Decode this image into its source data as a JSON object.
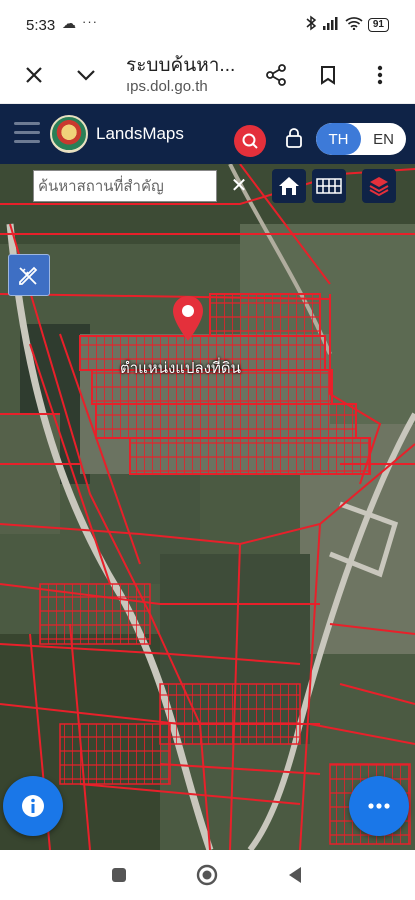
{
  "status": {
    "time": "5:33",
    "cloud_icon": "cloud-icon",
    "battery": "91"
  },
  "browser": {
    "title": "ระบบค้นหา...",
    "url": "ıps.dol.go.th"
  },
  "app": {
    "name": "LandsMaps",
    "lang_th": "TH",
    "lang_en": "EN"
  },
  "map": {
    "search_placeholder": "ค้นหาสถานที่สำคัญ",
    "clear_label": "✕",
    "pin_label": "ตำแหน่งแปลงที่ดิน",
    "parcel_line_color": "#e8202a"
  },
  "icons": [
    "home-icon",
    "grid-icon",
    "layers-icon",
    "pencil-ruler-icon",
    "info-icon",
    "more-icon",
    "location-pin-icon"
  ]
}
